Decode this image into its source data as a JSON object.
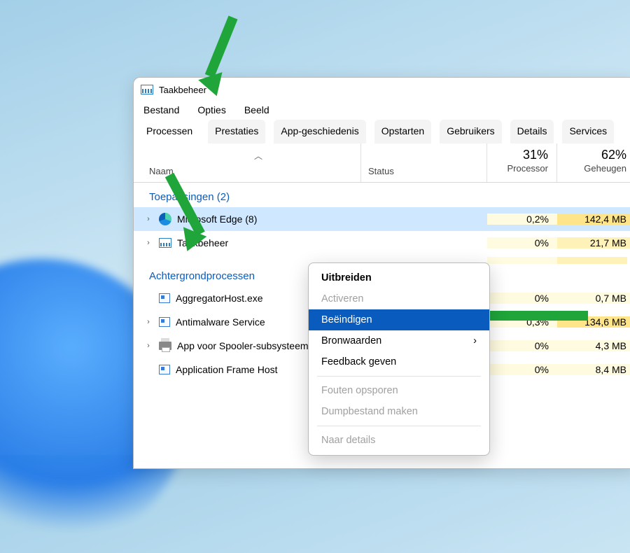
{
  "window": {
    "title": "Taakbeheer"
  },
  "menubar": [
    "Bestand",
    "Opties",
    "Beeld"
  ],
  "tabs": [
    "Processen",
    "Prestaties",
    "App-geschiedenis",
    "Opstarten",
    "Gebruikers",
    "Details",
    "Services"
  ],
  "active_tab": "Processen",
  "columns": {
    "name": "Naam",
    "status": "Status",
    "cpu_pct": "31%",
    "cpu_label": "Processor",
    "mem_pct": "62%",
    "mem_label": "Geheugen"
  },
  "groups": {
    "apps_heading": "Toepassingen (2)",
    "bg_heading": "Achtergrondprocessen"
  },
  "apps": [
    {
      "name": "Microsoft Edge (8)",
      "cpu": "0,2%",
      "mem": "142,4 MB",
      "icon": "edge",
      "expandable": true,
      "selected": true
    },
    {
      "name": "Taakbeheer",
      "cpu": "0%",
      "mem": "21,7 MB",
      "icon": "tm",
      "expandable": true,
      "selected": false
    }
  ],
  "bg_processes": [
    {
      "name": "AggregatorHost.exe",
      "cpu": "0%",
      "mem": "0,7 MB",
      "icon": "generic",
      "expandable": false
    },
    {
      "name": "Antimalware Service",
      "cpu": "0,3%",
      "mem": "134,6 MB",
      "icon": "generic",
      "expandable": true
    },
    {
      "name": "App voor Spooler-subsysteem",
      "cpu": "0%",
      "mem": "4,3 MB",
      "icon": "printer",
      "expandable": true
    },
    {
      "name": "Application Frame Host",
      "cpu": "0%",
      "mem": "8,4 MB",
      "icon": "generic",
      "expandable": false
    }
  ],
  "context_menu": {
    "expand": "Uitbreiden",
    "activate": "Activeren",
    "end": "Beëindigen",
    "values": "Bronwaarden",
    "feedback": "Feedback geven",
    "debug": "Fouten opsporen",
    "dump": "Dumpbestand maken",
    "details": "Naar details"
  }
}
